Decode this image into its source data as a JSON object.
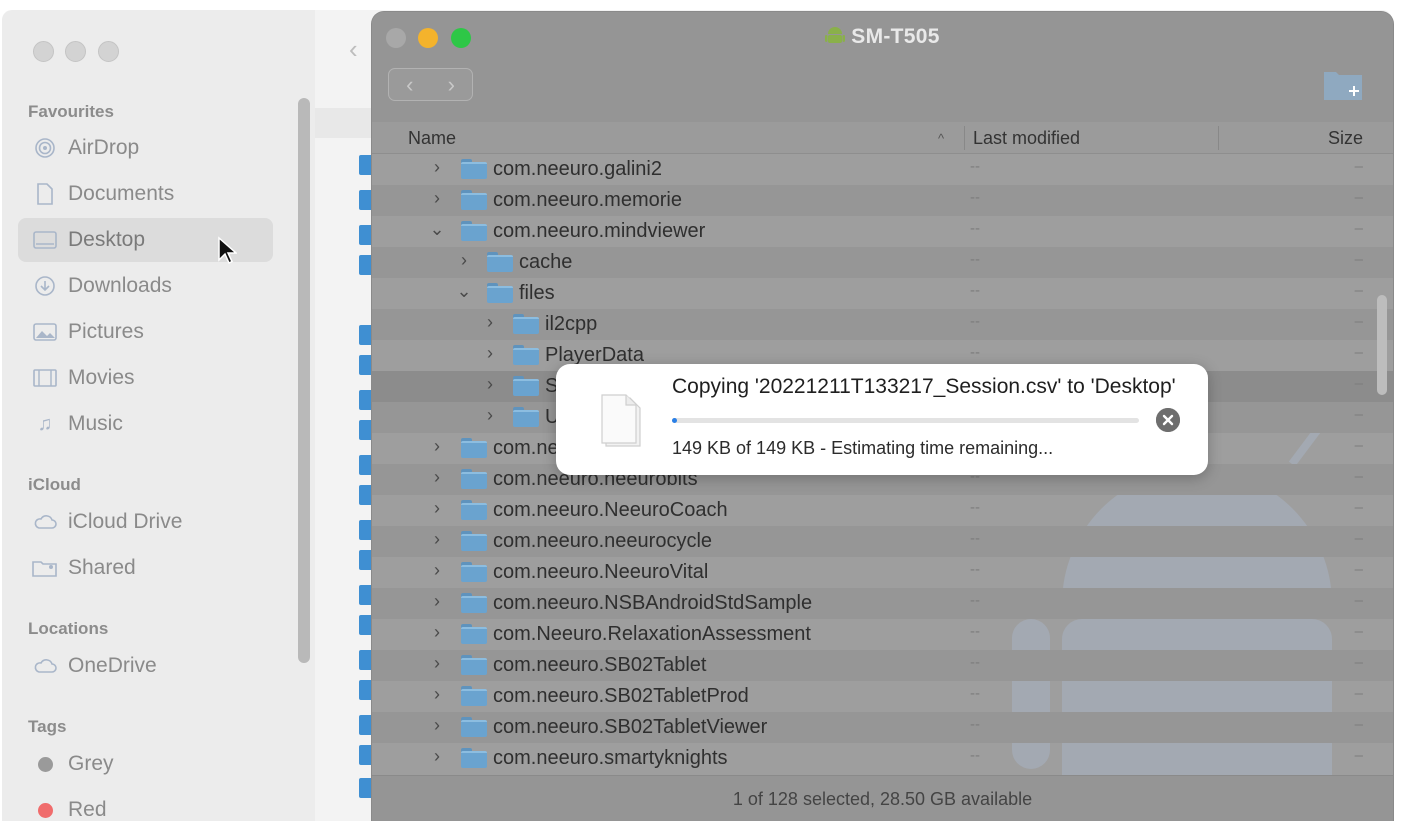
{
  "finder": {
    "sidebar": {
      "sections": [
        {
          "title": "Favourites",
          "items": [
            {
              "label": "AirDrop",
              "icon": "airdrop-icon"
            },
            {
              "label": "Documents",
              "icon": "document-icon"
            },
            {
              "label": "Desktop",
              "icon": "desktop-icon",
              "selected": true
            },
            {
              "label": "Downloads",
              "icon": "downloads-icon"
            },
            {
              "label": "Pictures",
              "icon": "pictures-icon"
            },
            {
              "label": "Movies",
              "icon": "movies-icon"
            },
            {
              "label": "Music",
              "icon": "music-icon"
            }
          ]
        },
        {
          "title": "iCloud",
          "items": [
            {
              "label": "iCloud Drive",
              "icon": "cloud-icon"
            },
            {
              "label": "Shared",
              "icon": "shared-folder-icon"
            }
          ]
        },
        {
          "title": "Locations",
          "items": [
            {
              "label": "OneDrive",
              "icon": "cloud-icon"
            }
          ]
        },
        {
          "title": "Tags",
          "items": [
            {
              "label": "Grey",
              "color": "#9a9a9a"
            },
            {
              "label": "Red",
              "color": "#f06c6c"
            }
          ]
        }
      ]
    }
  },
  "android_file_transfer": {
    "title": "SM-T505",
    "title_icon": "android-icon",
    "columns": {
      "name": "Name",
      "modified": "Last modified",
      "size": "Size"
    },
    "rows": [
      {
        "name": "com.neeuro.galini2",
        "modified": "--",
        "size": "–"
      },
      {
        "name": "com.neeuro.memorie",
        "modified": "--",
        "size": "–"
      },
      {
        "name": "com.neeuro.mindviewer",
        "modified": "--",
        "size": "–"
      },
      {
        "name": "cache",
        "modified": "--",
        "size": "–"
      },
      {
        "name": "files",
        "modified": "--",
        "size": "–"
      },
      {
        "name": "il2cpp",
        "modified": "--",
        "size": "–"
      },
      {
        "name": "PlayerData",
        "modified": "--",
        "size": "–"
      },
      {
        "name": "S",
        "modified": "--",
        "size": "–"
      },
      {
        "name": "U",
        "modified": "--",
        "size": "–"
      },
      {
        "name": "com.ne",
        "modified": "--",
        "size": "–"
      },
      {
        "name": "com.neeuro.neeurobits",
        "modified": "--",
        "size": "–"
      },
      {
        "name": "com.neeuro.NeeuroCoach",
        "modified": "--",
        "size": "–"
      },
      {
        "name": "com.neeuro.neeurocycle",
        "modified": "--",
        "size": "–"
      },
      {
        "name": "com.neeuro.NeeuroVital",
        "modified": "--",
        "size": "–"
      },
      {
        "name": "com.neeuro.NSBAndroidStdSample",
        "modified": "--",
        "size": "–"
      },
      {
        "name": "com.Neeuro.RelaxationAssessment",
        "modified": "--",
        "size": "–"
      },
      {
        "name": "com.neeuro.SB02Tablet",
        "modified": "--",
        "size": "–"
      },
      {
        "name": "com.neeuro.SB02TabletProd",
        "modified": "--",
        "size": "–"
      },
      {
        "name": "com.neeuro.SB02TabletViewer",
        "modified": "--",
        "size": "–"
      },
      {
        "name": "com.neeuro.smartyknights",
        "modified": "--",
        "size": "–"
      }
    ],
    "status": "1 of 128 selected, 28.50 GB available"
  },
  "copy_dialog": {
    "title": "Copying '20221211T133217_Session.csv' to 'Desktop'",
    "progress_percent": 1,
    "status": "149 KB of 149 KB - Estimating time remaining..."
  },
  "colors": {
    "accent": "#2a7fe6",
    "folder": "#6aa3cf"
  }
}
